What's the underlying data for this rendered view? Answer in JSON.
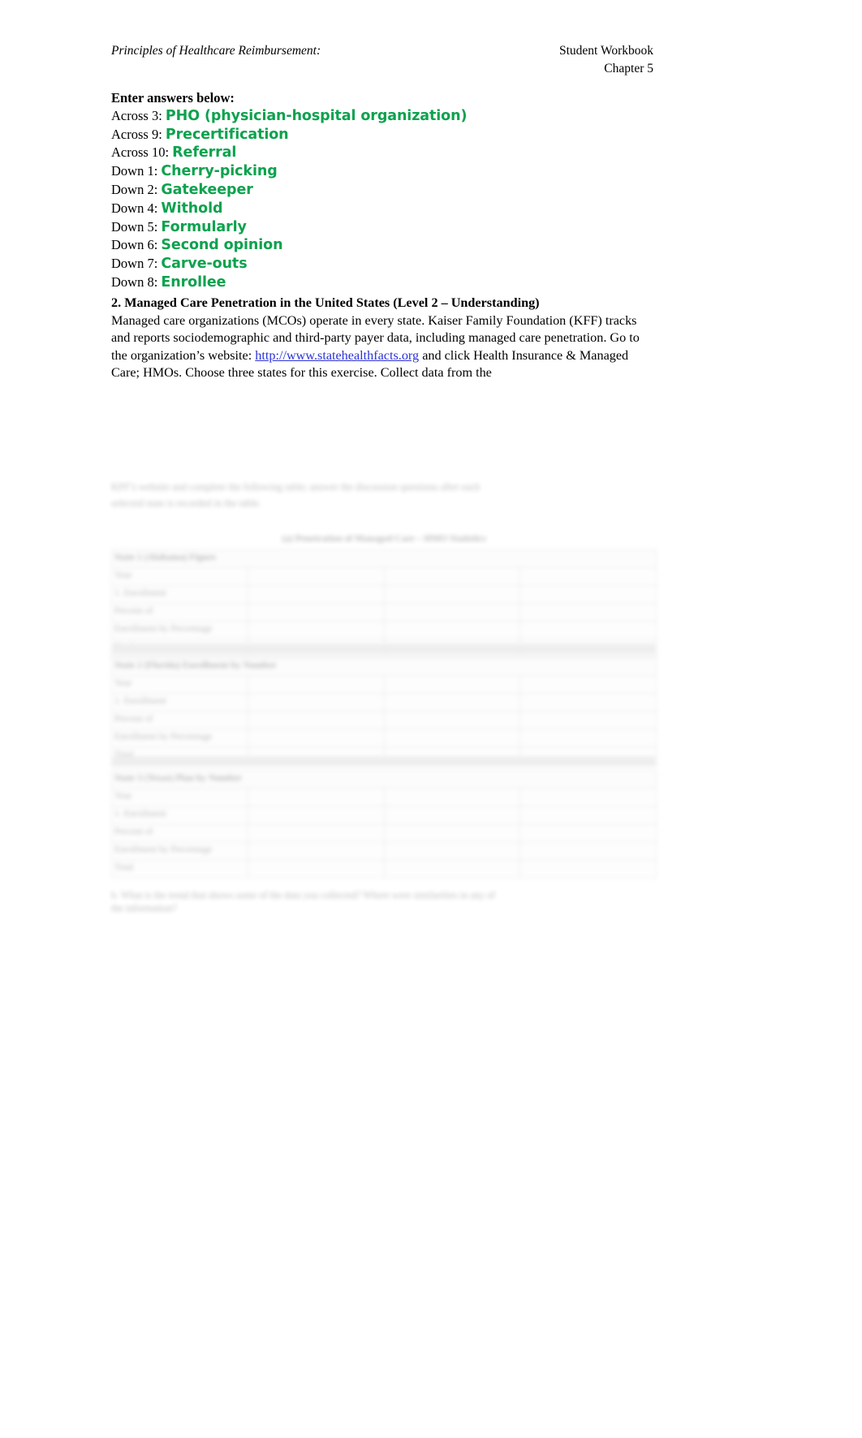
{
  "document": {
    "header": {
      "left_title": "Principles of Healthcare Reimbursement:",
      "right_line1": "Student Workbook",
      "right_line2": "Chapter 5"
    },
    "answers_section": {
      "title": "Enter answers below:",
      "accent_color": "#0DA24E",
      "items": [
        {
          "label": "Across 3:",
          "value": "PHO (physician-hospital organization)"
        },
        {
          "label": "Across 9:",
          "value": "Precertification"
        },
        {
          "label": "Across 10:",
          "value": "Referral"
        },
        {
          "label": "Down 1:",
          "value": "Cherry-picking"
        },
        {
          "label": "Down 2:",
          "value": "Gatekeeper"
        },
        {
          "label": "Down 4:",
          "value": "Withold"
        },
        {
          "label": "Down 5:",
          "value": "Formularly"
        },
        {
          "label": "Down 6:",
          "value": "Second opinion"
        },
        {
          "label": "Down 7:",
          "value": "Carve-outs"
        },
        {
          "label": "Down 8:",
          "value": "Enrollee"
        }
      ]
    },
    "section2": {
      "heading": "2. Managed Care Penetration in the United States (Level 2 – Understanding)",
      "para_part1": "Managed care organizations (MCOs) operate in every state. Kaiser Family Foundation (KFF) tracks and reports sociodemographic and third-party payer data, including managed care penetration.  Go to the organization’s website: ",
      "link_text": "http://www.statehealthfacts.org",
      "link_color": "#2B32D6",
      "para_part2": "  and click Health Insurance & Managed Care; HMOs. Choose three states for this exercise. Collect data from the"
    },
    "blurred_section": {
      "intro_line1": "KFF’s website and complete the following table; answer the discussion questions after each",
      "intro_line2": "selected state is recorded in the table.",
      "table_caption": "(a) Penetration of Managed Care – HMO Statistics",
      "blocks": [
        {
          "state_label": "State 1 (Alabama) Figure",
          "rows": [
            "Year",
            "1. Enrollment",
            "Percent of",
            "Enrollment by Percentage",
            "Total"
          ]
        },
        {
          "state_label": "State 2 (Florida) Enrollment by Number",
          "rows": [
            "Year",
            "1. Enrollment",
            "Percent of",
            "Enrollment by Percentage",
            "Total"
          ]
        },
        {
          "state_label": "State 3 (Texas) Plan by Number",
          "rows": [
            "Year",
            "1. Enrollment",
            "Percent of",
            "Enrollment by Percentage",
            "Total"
          ]
        }
      ],
      "footnote_line1": "b. What is the trend that shows some of the data you collected? Where were similarities in any of",
      "footnote_line2": "the information?"
    }
  }
}
